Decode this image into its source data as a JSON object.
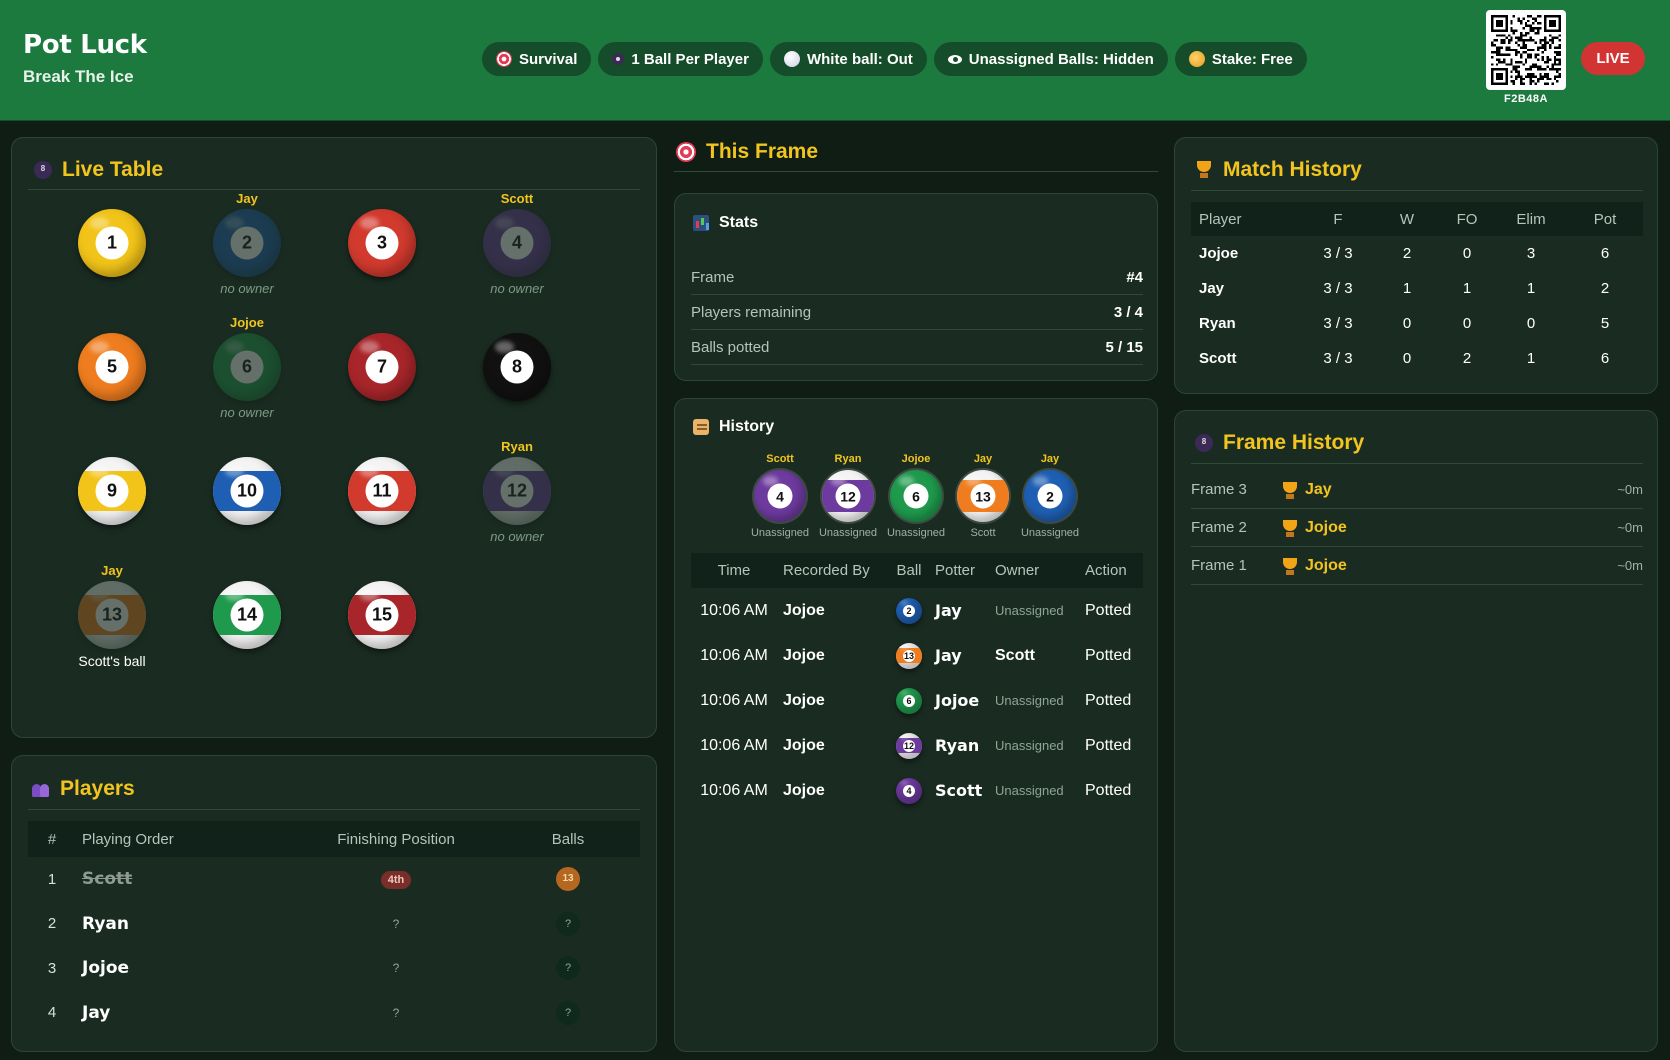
{
  "header": {
    "title": "Pot Luck",
    "subtitle": "Break The Ice",
    "chips": [
      {
        "label": "Survival",
        "icon": "target-icon"
      },
      {
        "label": "1 Ball Per Player",
        "icon": "eightball-icon"
      },
      {
        "label": "White ball: Out",
        "icon": "whiteball-icon"
      },
      {
        "label": "Unassigned Balls: Hidden",
        "icon": "eye-icon"
      },
      {
        "label": "Stake: Free",
        "icon": "coin-icon"
      }
    ],
    "qr_code": "F2B48A",
    "live_label": "LIVE"
  },
  "live_table": {
    "title": "Live Table",
    "balls": [
      {
        "number": "1",
        "color": "#f2c419",
        "stripe": false,
        "faded": false,
        "owner": "",
        "note": ""
      },
      {
        "number": "2",
        "color": "#1f5fb3",
        "stripe": false,
        "faded": true,
        "owner": "Jay",
        "note": "no owner"
      },
      {
        "number": "3",
        "color": "#d23a2e",
        "stripe": false,
        "faded": false,
        "owner": "",
        "note": ""
      },
      {
        "number": "4",
        "color": "#6d3a9e",
        "stripe": false,
        "faded": true,
        "owner": "Scott",
        "note": "no owner"
      },
      {
        "number": "5",
        "color": "#ef7d1f",
        "stripe": false,
        "faded": false,
        "owner": "",
        "note": ""
      },
      {
        "number": "6",
        "color": "#1f9a4d",
        "stripe": false,
        "faded": true,
        "owner": "Jojoe",
        "note": "no owner"
      },
      {
        "number": "7",
        "color": "#a8262a",
        "stripe": false,
        "faded": false,
        "owner": "",
        "note": ""
      },
      {
        "number": "8",
        "color": "#111111",
        "stripe": false,
        "faded": false,
        "owner": "",
        "note": ""
      },
      {
        "number": "9",
        "color": "#f2c419",
        "stripe": true,
        "faded": false,
        "owner": "",
        "note": ""
      },
      {
        "number": "10",
        "color": "#1f5fb3",
        "stripe": true,
        "faded": false,
        "owner": "",
        "note": ""
      },
      {
        "number": "11",
        "color": "#d23a2e",
        "stripe": true,
        "faded": false,
        "owner": "",
        "note": ""
      },
      {
        "number": "12",
        "color": "#6d3a9e",
        "stripe": true,
        "faded": true,
        "owner": "Ryan",
        "note": "no owner"
      },
      {
        "number": "13",
        "color": "#ef7d1f",
        "stripe": true,
        "faded": true,
        "owner": "Jay",
        "note": "Scott's ball"
      },
      {
        "number": "14",
        "color": "#1f9a4d",
        "stripe": true,
        "faded": false,
        "owner": "",
        "note": ""
      },
      {
        "number": "15",
        "color": "#a8262a",
        "stripe": true,
        "faded": false,
        "owner": "",
        "note": ""
      }
    ]
  },
  "players": {
    "title": "Players",
    "columns": [
      "#",
      "Playing Order",
      "Finishing Position",
      "Balls"
    ],
    "rows": [
      {
        "num": "1",
        "name": "Scott",
        "eliminated": true,
        "position": "4th",
        "ball": "13"
      },
      {
        "num": "2",
        "name": "Ryan",
        "eliminated": false,
        "position": "?",
        "ball": "?"
      },
      {
        "num": "3",
        "name": "Jojoe",
        "eliminated": false,
        "position": "?",
        "ball": "?"
      },
      {
        "num": "4",
        "name": "Jay",
        "eliminated": false,
        "position": "?",
        "ball": "?"
      }
    ]
  },
  "this_frame": {
    "title": "This Frame",
    "stats": {
      "title": "Stats",
      "rows": [
        {
          "label": "Frame",
          "value": "#4"
        },
        {
          "label": "Players remaining",
          "value": "3 / 4"
        },
        {
          "label": "Balls potted",
          "value": "5 / 15"
        }
      ]
    },
    "history": {
      "title": "History",
      "strip": [
        {
          "player": "Scott",
          "ball": "4",
          "color": "#6d3a9e",
          "stripe": false,
          "owner": "Unassigned"
        },
        {
          "player": "Ryan",
          "ball": "12",
          "color": "#6d3a9e",
          "stripe": true,
          "owner": "Unassigned"
        },
        {
          "player": "Jojoe",
          "ball": "6",
          "color": "#1f9a4d",
          "stripe": false,
          "owner": "Unassigned"
        },
        {
          "player": "Jay",
          "ball": "13",
          "color": "#ef7d1f",
          "stripe": true,
          "owner": "Scott"
        },
        {
          "player": "Jay",
          "ball": "2",
          "color": "#1f5fb3",
          "stripe": false,
          "owner": "Unassigned"
        }
      ],
      "columns": [
        "Time",
        "Recorded By",
        "Ball",
        "Potter",
        "Owner",
        "Action"
      ],
      "rows": [
        {
          "time": "10:06 AM",
          "recorded_by": "Jojoe",
          "ball": "2",
          "color": "#1f5fb3",
          "stripe": false,
          "potter": "Jay",
          "owner": "Unassigned",
          "action": "Potted"
        },
        {
          "time": "10:06 AM",
          "recorded_by": "Jojoe",
          "ball": "13",
          "color": "#ef7d1f",
          "stripe": true,
          "potter": "Jay",
          "owner": "Scott",
          "action": "Potted"
        },
        {
          "time": "10:06 AM",
          "recorded_by": "Jojoe",
          "ball": "6",
          "color": "#1f9a4d",
          "stripe": false,
          "potter": "Jojoe",
          "owner": "Unassigned",
          "action": "Potted"
        },
        {
          "time": "10:06 AM",
          "recorded_by": "Jojoe",
          "ball": "12",
          "color": "#6d3a9e",
          "stripe": true,
          "potter": "Ryan",
          "owner": "Unassigned",
          "action": "Potted"
        },
        {
          "time": "10:06 AM",
          "recorded_by": "Jojoe",
          "ball": "4",
          "color": "#6d3a9e",
          "stripe": false,
          "potter": "Scott",
          "owner": "Unassigned",
          "action": "Potted"
        }
      ]
    }
  },
  "match_history": {
    "title": "Match History",
    "columns": [
      "Player",
      "F",
      "W",
      "FO",
      "Elim",
      "Pot"
    ],
    "rows": [
      {
        "player": "Jojoe",
        "f": "3 / 3",
        "w": "2",
        "fo": "0",
        "elim": "3",
        "pot": "6"
      },
      {
        "player": "Jay",
        "f": "3 / 3",
        "w": "1",
        "fo": "1",
        "elim": "1",
        "pot": "2"
      },
      {
        "player": "Ryan",
        "f": "3 / 3",
        "w": "0",
        "fo": "0",
        "elim": "0",
        "pot": "5"
      },
      {
        "player": "Scott",
        "f": "3 / 3",
        "w": "0",
        "fo": "2",
        "elim": "1",
        "pot": "6"
      }
    ]
  },
  "frame_history": {
    "title": "Frame History",
    "rows": [
      {
        "frame": "Frame 3",
        "winner": "Jay",
        "duration": "~0m"
      },
      {
        "frame": "Frame 2",
        "winner": "Jojoe",
        "duration": "~0m"
      },
      {
        "frame": "Frame 1",
        "winner": "Jojoe",
        "duration": "~0m"
      }
    ]
  },
  "colors": {
    "header_bg": "#1c7a3f",
    "accent": "#f2c41e",
    "live": "#d23434",
    "panel_bg": "#1a2c22"
  }
}
